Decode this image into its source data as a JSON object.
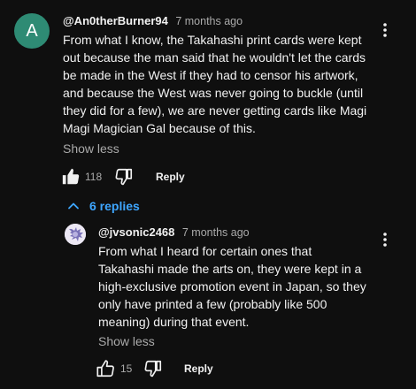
{
  "comment": {
    "avatar_letter": "A",
    "author": "@An0therBurner94",
    "time": "7 months ago",
    "lines": [
      "From what I know, the Takahashi print cards were kept",
      "out because the man said that he wouldn't let the cards",
      "be made in the West if they had to censor his artwork,",
      "and because the West was never going to buckle (until",
      "they did for a few), we are never getting cards like Magi",
      "Magi Magician Gal because of this."
    ],
    "show_less": "Show less",
    "like_count": "118",
    "reply_label": "Reply"
  },
  "replies_toggle": {
    "label": "6 replies"
  },
  "reply": {
    "author": "@jvsonic2468",
    "time": "7 months ago",
    "lines": [
      "From what I heard for certain ones that",
      "Takahashi made the arts on, they were kept in a",
      "high-exclusive promotion event in Japan, so they",
      "only have printed a few (probably like 500",
      "meaning) during that event."
    ],
    "show_less": "Show less",
    "like_count": "15",
    "reply_label": "Reply"
  },
  "colors": {
    "background": "#0f0f0f",
    "text": "#f1f1f1",
    "muted": "#aaaaaa",
    "link_blue": "#3ea6ff",
    "avatar_green": "#2e8b74"
  },
  "icons": [
    "kebab-menu-icon",
    "thumbs-up-icon",
    "thumbs-down-icon",
    "chevron-up-icon"
  ]
}
